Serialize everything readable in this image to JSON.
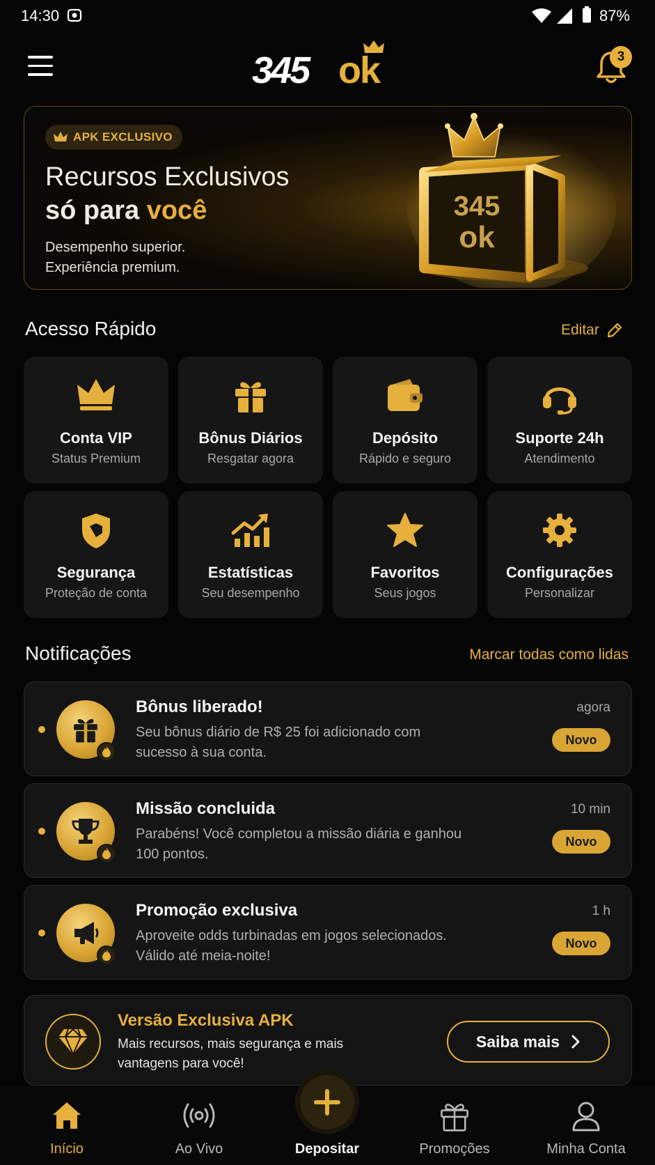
{
  "status": {
    "time": "14:30",
    "battery": "87%"
  },
  "header": {
    "logo_number": "345",
    "logo_ok": "ok",
    "notification_count": "3"
  },
  "banner": {
    "tag": "APK EXCLUSIVO",
    "title_line1": "Recursos Exclusivos",
    "title_line2_prefix": "só para ",
    "title_line2_highlight": "você",
    "subtitle_line1": "Desempenho superior.",
    "subtitle_line2": "Experiência premium.",
    "chest_text_top": "345",
    "chest_text_bottom": "ok"
  },
  "quick_access": {
    "title": "Acesso Rápido",
    "edit_label": "Editar",
    "tiles": [
      {
        "icon": "crown-icon",
        "title": "Conta VIP",
        "subtitle": "Status Premium"
      },
      {
        "icon": "gift-icon",
        "title": "Bônus Diários",
        "subtitle": "Resgatar agora"
      },
      {
        "icon": "wallet-icon",
        "title": "Depósito",
        "subtitle": "Rápido e seguro"
      },
      {
        "icon": "headset-icon",
        "title": "Suporte 24h",
        "subtitle": "Atendimento"
      },
      {
        "icon": "shield-icon",
        "title": "Segurança",
        "subtitle": "Proteção de conta"
      },
      {
        "icon": "chart-up-icon",
        "title": "Estatísticas",
        "subtitle": "Seu desempenho"
      },
      {
        "icon": "star-icon",
        "title": "Favoritos",
        "subtitle": "Seus jogos"
      },
      {
        "icon": "gear-icon",
        "title": "Configurações",
        "subtitle": "Personalizar"
      }
    ]
  },
  "notifications": {
    "title": "Notificações",
    "mark_all_label": "Marcar todas como lidas",
    "items": [
      {
        "icon": "gift-icon",
        "title": "Bônus liberado!",
        "text": "Seu bônus diário de R$ 25 foi adicionado com sucesso à sua conta.",
        "time": "agora",
        "badge": "Novo"
      },
      {
        "icon": "trophy-icon",
        "title": "Missão concluida",
        "text": "Parabéns! Você completou a missão diária e ganhou 100 pontos.",
        "time": "10 min",
        "badge": "Novo"
      },
      {
        "icon": "megaphone-icon",
        "title": "Promoção exclusiva",
        "text": "Aproveite odds turbinadas em jogos selecionados. Válido até meia-noite!",
        "time": "1 h",
        "badge": "Novo"
      }
    ]
  },
  "promo": {
    "icon": "diamond-icon",
    "title": "Versão Exclusiva APK",
    "text": "Mais recursos, mais segurança e mais vantagens para você!",
    "button_label": "Saiba mais"
  },
  "bottom_nav": {
    "items": [
      {
        "icon": "home-icon",
        "label": "Início"
      },
      {
        "icon": "broadcast-icon",
        "label": "Ao Vivo"
      },
      {
        "icon": "plus-icon",
        "label": "Depositar"
      },
      {
        "icon": "gift-icon",
        "label": "Promoções"
      },
      {
        "icon": "user-icon",
        "label": "Minha Conta"
      }
    ]
  },
  "colors": {
    "accent": "#e6b03c",
    "background": "#050505",
    "card": "#161616"
  }
}
